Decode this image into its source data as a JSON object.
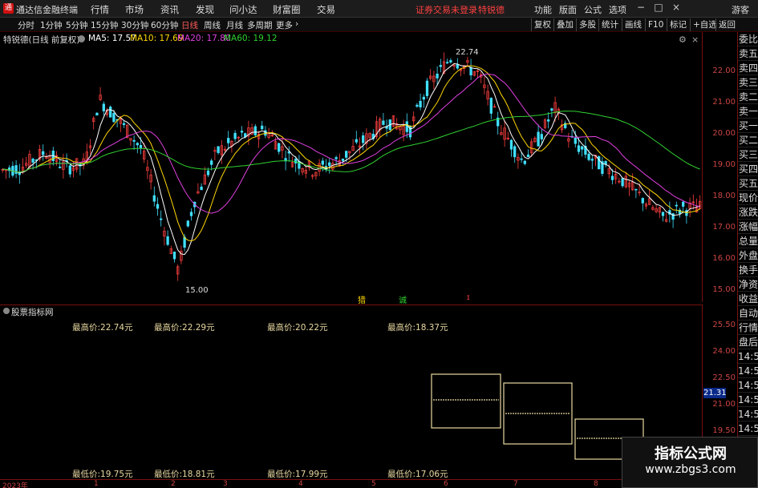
{
  "window": {
    "logo_char": "通",
    "app_title": "通达信金融终端",
    "menu": [
      "行情",
      "市场",
      "资讯",
      "发现",
      "问小达",
      "财富圈",
      "交易"
    ],
    "warning": "证券交易未登录",
    "stock_name": "特锐德",
    "right_menu": [
      "功能",
      "版面",
      "公式",
      "选项"
    ],
    "guest": "游客",
    "win_buttons": [
      "−",
      "□",
      "×"
    ]
  },
  "toolbar": {
    "periods": [
      "分时",
      "1分钟",
      "5分钟",
      "15分钟",
      "30分钟",
      "60分钟",
      "日线",
      "周线",
      "月线",
      "多周期",
      "更多"
    ],
    "active_period": "日线",
    "more_arrow": "›",
    "tools": [
      "复权",
      "叠加",
      "多股",
      "统计",
      "画线",
      "F10",
      "标记",
      "+自选",
      "返回"
    ]
  },
  "main_chart": {
    "info": {
      "name": "特锐德(日线 前复权)",
      "ma5": "MA5: 17.57",
      "ma10": "MA10: 17.69",
      "ma20": "MA20: 17.80",
      "ma60": "MA60: 19.12"
    },
    "colors": {
      "ma5": "#ffffff",
      "ma10": "#ffd700",
      "ma20": "#e040e0",
      "ma60": "#30d030",
      "up": "#ff4040",
      "down": "#40e0ff"
    },
    "high_label": "22.74",
    "low_label": "15.00",
    "y_ticks": [
      "22.00",
      "21.00",
      "20.00",
      "19.00",
      "18.00",
      "17.00",
      "16.00",
      "15.00"
    ],
    "markers": [
      {
        "text": "猎",
        "color": "#ffd700"
      },
      {
        "text": "诚",
        "color": "#30d030"
      },
      {
        "text": "ɪ",
        "color": "#ff4040"
      }
    ]
  },
  "sub_chart": {
    "title": "股票指标网",
    "highs": [
      "最高价:22.74元",
      "最高价:22.29元",
      "最高价:20.22元",
      "最高价:18.37元"
    ],
    "lows": [
      "最低价:19.75元",
      "最低价:18.81元",
      "最低价:17.99元",
      "最低价:17.06元"
    ],
    "y_ticks": [
      "25.50",
      "24.00",
      "22.50",
      "21.00",
      "19.50"
    ],
    "current": "21.31"
  },
  "right_panel": {
    "items": [
      "委比",
      "卖五",
      "卖四",
      "卖三",
      "卖二",
      "卖一",
      "买一",
      "买二",
      "买三",
      "买四",
      "买五",
      "现价",
      "涨跌",
      "涨幅",
      "总量",
      "外盘",
      "换手",
      "净资",
      "收益",
      "自动",
      "行情",
      "盘后",
      "14:5",
      "14:5",
      "14:5",
      "14:5",
      "14:5",
      "14:5",
      "14:5",
      "14:5",
      "14:5"
    ],
    "settings_icon": "⚙"
  },
  "x_axis": {
    "labels": [
      "2023年",
      "1",
      "2",
      "3",
      "4",
      "5",
      "6",
      "7",
      "8"
    ]
  },
  "watermark": {
    "line1": "指标公式网",
    "line2": "www.zbgs3.com"
  }
}
